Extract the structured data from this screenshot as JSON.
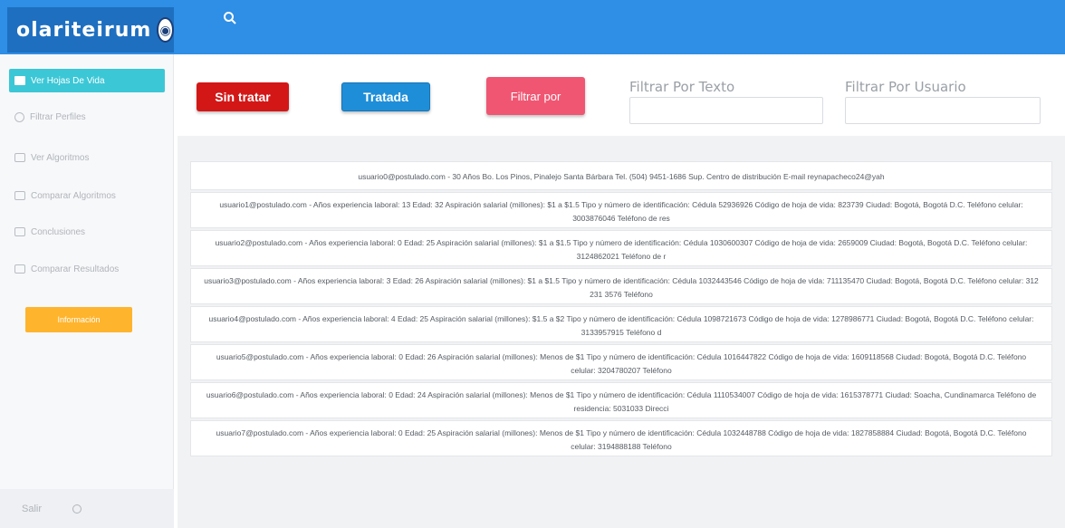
{
  "header": {
    "logo_text": "olariteirum",
    "search_icon": "search-icon"
  },
  "sidebar": {
    "items": [
      {
        "label": "Ver Hojas De Vida",
        "icon": "document-icon",
        "active": true
      },
      {
        "label": "Filtrar Perfiles",
        "icon": "filter-icon",
        "active": false
      },
      {
        "label": "Ver Algoritmos",
        "icon": "list-icon",
        "active": false
      },
      {
        "label": "Comparar Algoritmos",
        "icon": "chart-icon",
        "active": false
      },
      {
        "label": "Conclusiones",
        "icon": "folder-icon",
        "active": false
      },
      {
        "label": "Comparar Resultados",
        "icon": "file-icon",
        "active": false
      }
    ],
    "info_button": "Información",
    "footer_label": "Salir",
    "footer_icon": "power-icon"
  },
  "filters": {
    "untreated_label": "Sin tratar",
    "treated_label": "Tratada",
    "filter_by_label": "Filtrar por",
    "text_filter_label": "Filtrar Por Texto",
    "text_filter_value": "",
    "user_filter_label": "Filtrar Por Usuario",
    "user_filter_value": ""
  },
  "colors": {
    "topbar": "#2f8ee5",
    "active_item": "#3cc7d6",
    "btn_red": "#d31717",
    "btn_blue": "#1f8ed8",
    "btn_pink": "#f05672",
    "info_btn": "#ffb42e"
  },
  "resumes": [
    "usuario0@postulado.com - 30 Años Bo. Los Pinos, Pinalejo Santa Bárbara Tel. (504) 9451-1686 Sup. Centro de distribución E-mail reynapacheco24@yah",
    "usuario1@postulado.com - Años experiencia laboral: 13 Edad: 32 Aspiración salarial (millones): $1 a $1.5 Tipo y número de identificación: Cédula 52936926 Código de hoja de vida: 823739 Ciudad: Bogotá, Bogotá D.C. Teléfono celular: 3003876046 Teléfono de res",
    "usuario2@postulado.com - Años experiencia laboral: 0 Edad: 25 Aspiración salarial (millones): $1 a $1.5 Tipo y número de identificación: Cédula 1030600307 Código de hoja de vida: 2659009 Ciudad: Bogotá, Bogotá D.C. Teléfono celular: 3124862021 Teléfono de r",
    "usuario3@postulado.com - Años experiencia laboral: 3 Edad: 26 Aspiración salarial (millones): $1 a $1.5 Tipo y número de identificación: Cédula 1032443546 Código de hoja de vida: 711135470 Ciudad: Bogotá, Bogotá D.C. Teléfono celular: 312 231 3576 Teléfono",
    "usuario4@postulado.com - Años experiencia laboral: 4 Edad: 25 Aspiración salarial (millones): $1.5 a $2 Tipo y número de identificación: Cédula 1098721673 Código de hoja de vida: 1278986771 Ciudad: Bogotá, Bogotá D.C. Teléfono celular: 3133957915 Teléfono d",
    "usuario5@postulado.com - Años experiencia laboral: 0 Edad: 26 Aspiración salarial (millones): Menos de $1 Tipo y número de identificación: Cédula 1016447822 Código de hoja de vida: 1609118568 Ciudad: Bogotá, Bogotá D.C. Teléfono celular: 3204780207 Teléfono",
    "usuario6@postulado.com - Años experiencia laboral: 0 Edad: 24 Aspiración salarial (millones): Menos de $1 Tipo y número de identificación: Cédula 1110534007 Código de hoja de vida: 1615378771 Ciudad: Soacha, Cundinamarca Teléfono de residencia: 5031033 Direcci",
    "usuario7@postulado.com - Años experiencia laboral: 0 Edad: 25 Aspiración salarial (millones): Menos de $1 Tipo y número de identificación: Cédula 1032448788 Código de hoja de vida: 1827858884 Ciudad: Bogotá, Bogotá D.C. Teléfono celular: 3194888188 Teléfono"
  ]
}
